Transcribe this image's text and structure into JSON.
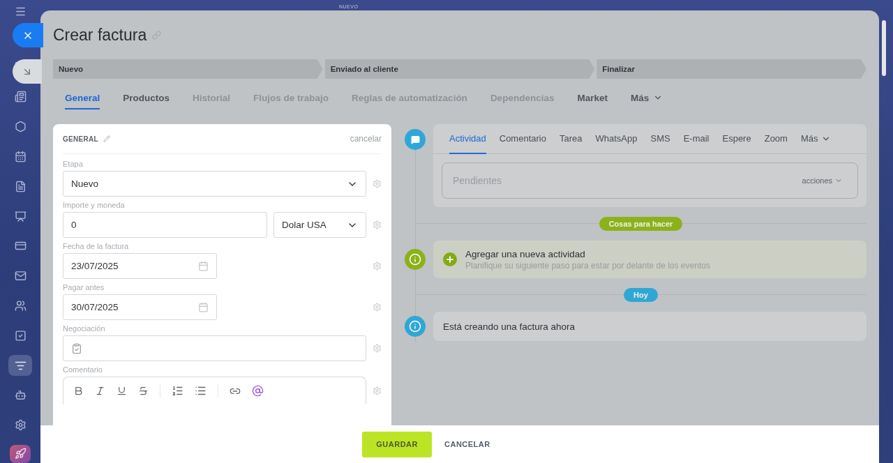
{
  "background_badge": "NUEVO",
  "sidebar": {
    "items": [
      {
        "selected": false
      },
      {
        "selected": false
      },
      {
        "selected": false
      },
      {
        "selected": false
      },
      {
        "selected": false
      },
      {
        "selected": false
      },
      {
        "selected": false
      },
      {
        "selected": false
      },
      {
        "selected": false
      },
      {
        "selected": false
      },
      {
        "selected": false
      },
      {
        "selected": true
      },
      {
        "selected": false
      },
      {
        "selected": false
      },
      {
        "selected": false
      }
    ]
  },
  "title": "Crear factura",
  "stages": [
    {
      "label": "Nuevo"
    },
    {
      "label": "Enviado al cliente"
    },
    {
      "label": "Finalizar"
    }
  ],
  "tabs": [
    {
      "label": "General",
      "selected": true,
      "disabled": false
    },
    {
      "label": "Productos",
      "selected": false,
      "disabled": false
    },
    {
      "label": "Historial",
      "selected": false,
      "disabled": true
    },
    {
      "label": "Flujos de trabajo",
      "selected": false,
      "disabled": true
    },
    {
      "label": "Reglas de automatización",
      "selected": false,
      "disabled": true
    },
    {
      "label": "Dependencias",
      "selected": false,
      "disabled": true
    },
    {
      "label": "Market",
      "selected": false,
      "disabled": false
    },
    {
      "label": "Más",
      "selected": false,
      "disabled": false,
      "kind": "more"
    }
  ],
  "form": {
    "heading": "GENERAL",
    "cancel": "cancelar",
    "fields": [
      {
        "kind": "select",
        "label": "Etapa",
        "value": "Nuevo"
      },
      {
        "kind": "money",
        "label": "Importe y moneda",
        "value": "0",
        "currency": "Dolar USA"
      },
      {
        "kind": "date",
        "label": "Fecha de la factura",
        "value": "23/07/2025"
      },
      {
        "kind": "date",
        "label": "Pagar antes",
        "value": "30/07/2025"
      },
      {
        "kind": "entity",
        "label": "Negociación"
      },
      {
        "kind": "editor",
        "label": "Comentario"
      }
    ]
  },
  "activity": {
    "tabs": [
      {
        "label": "Actividad",
        "selected": true
      },
      {
        "label": "Comentario",
        "selected": false
      },
      {
        "label": "Tarea",
        "selected": false
      },
      {
        "label": "WhatsApp",
        "selected": false
      },
      {
        "label": "SMS",
        "selected": false
      },
      {
        "label": "E-mail",
        "selected": false
      },
      {
        "label": "Espere",
        "selected": false
      },
      {
        "label": "Zoom",
        "selected": false
      },
      {
        "label": "Más",
        "selected": false,
        "kind": "more"
      }
    ],
    "placeholder": "Pendientes",
    "actions": "acciones",
    "sections": [
      {
        "badge": "Cosas para hacer",
        "color": "#8db11a",
        "items": [
          {
            "kind": "add",
            "title": "Agregar una nueva actividad",
            "subtitle": "Planifique su siguiente paso para estar por delante de los eventos"
          }
        ]
      },
      {
        "badge": "Hoy",
        "color": "#2fa7d6",
        "items": [
          {
            "kind": "info",
            "title": "Está creando una factura ahora"
          }
        ]
      }
    ]
  },
  "footer": {
    "save": "GUARDAR",
    "cancel": "CANCELAR"
  }
}
